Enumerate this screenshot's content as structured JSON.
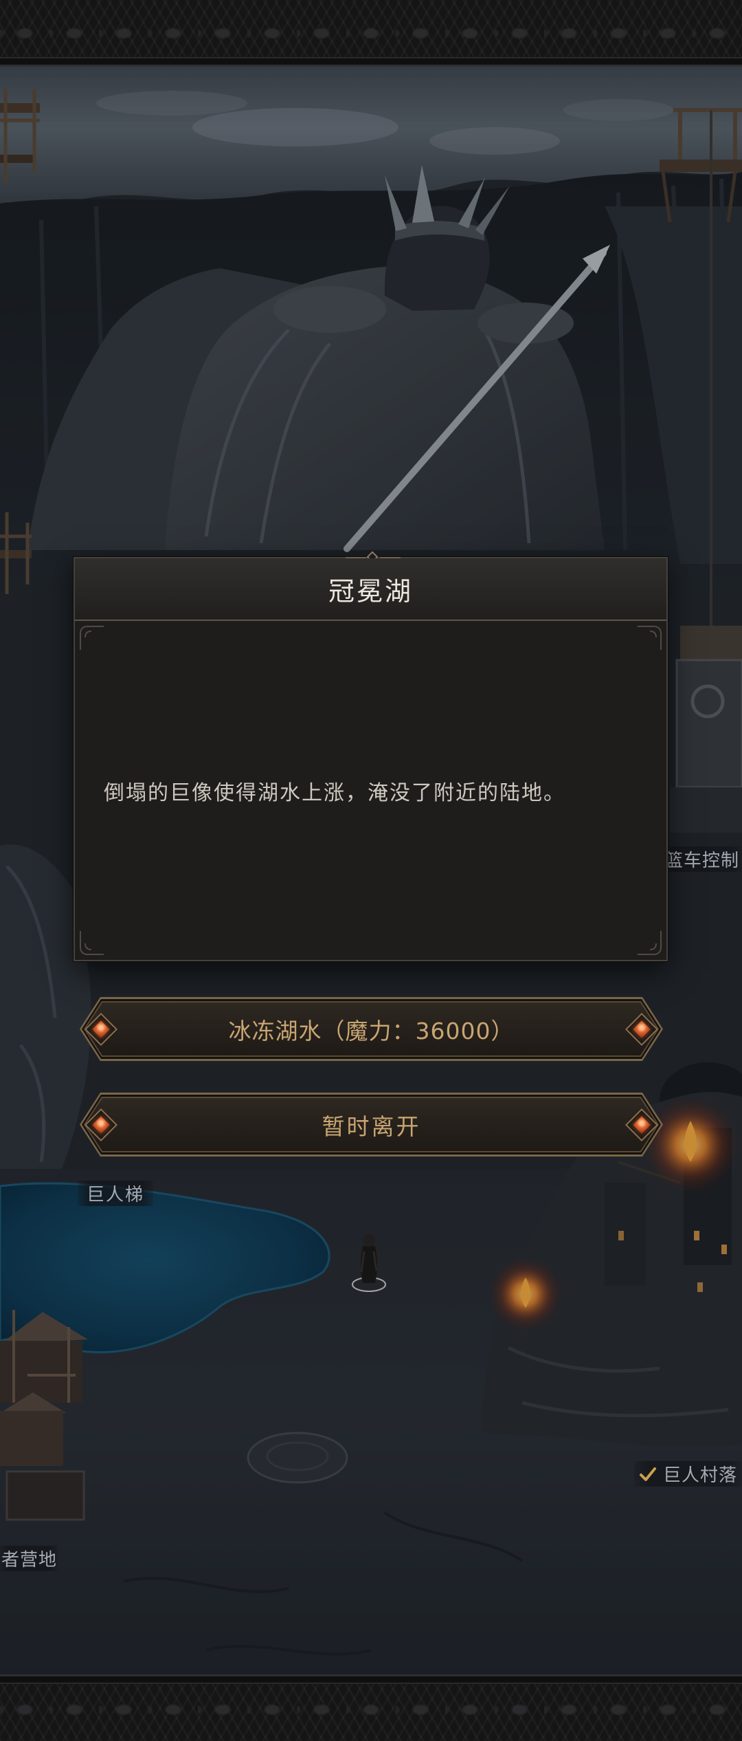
{
  "dialog": {
    "title": "冠冕湖",
    "description": "倒塌的巨像使得湖水上涨，淹没了附近的陆地。",
    "top_ornament_icon": "diamond-ornament-icon",
    "corner_icon": "corner-flourish-icon"
  },
  "actions": [
    {
      "label": "冰冻湖水（魔力：36000）",
      "end_icon": "orange-gem-icon"
    },
    {
      "label": "暂时离开",
      "end_icon": "orange-gem-icon"
    }
  ],
  "map_labels": [
    {
      "text": "篮车控制"
    },
    {
      "text": "巨人梯"
    },
    {
      "text": "巨人村落",
      "icon": "checkmark-icon"
    },
    {
      "text": "者营地"
    }
  ],
  "colors": {
    "dialog_background": "#1e1d1c",
    "title_text": "#ece7de",
    "body_text": "#cec8bf",
    "button_text": "#c9a571",
    "button_border": "#7a6648",
    "gem": "#e0622f",
    "map_label_text": "#a5abb3",
    "checkmark": "#c9a24a"
  }
}
